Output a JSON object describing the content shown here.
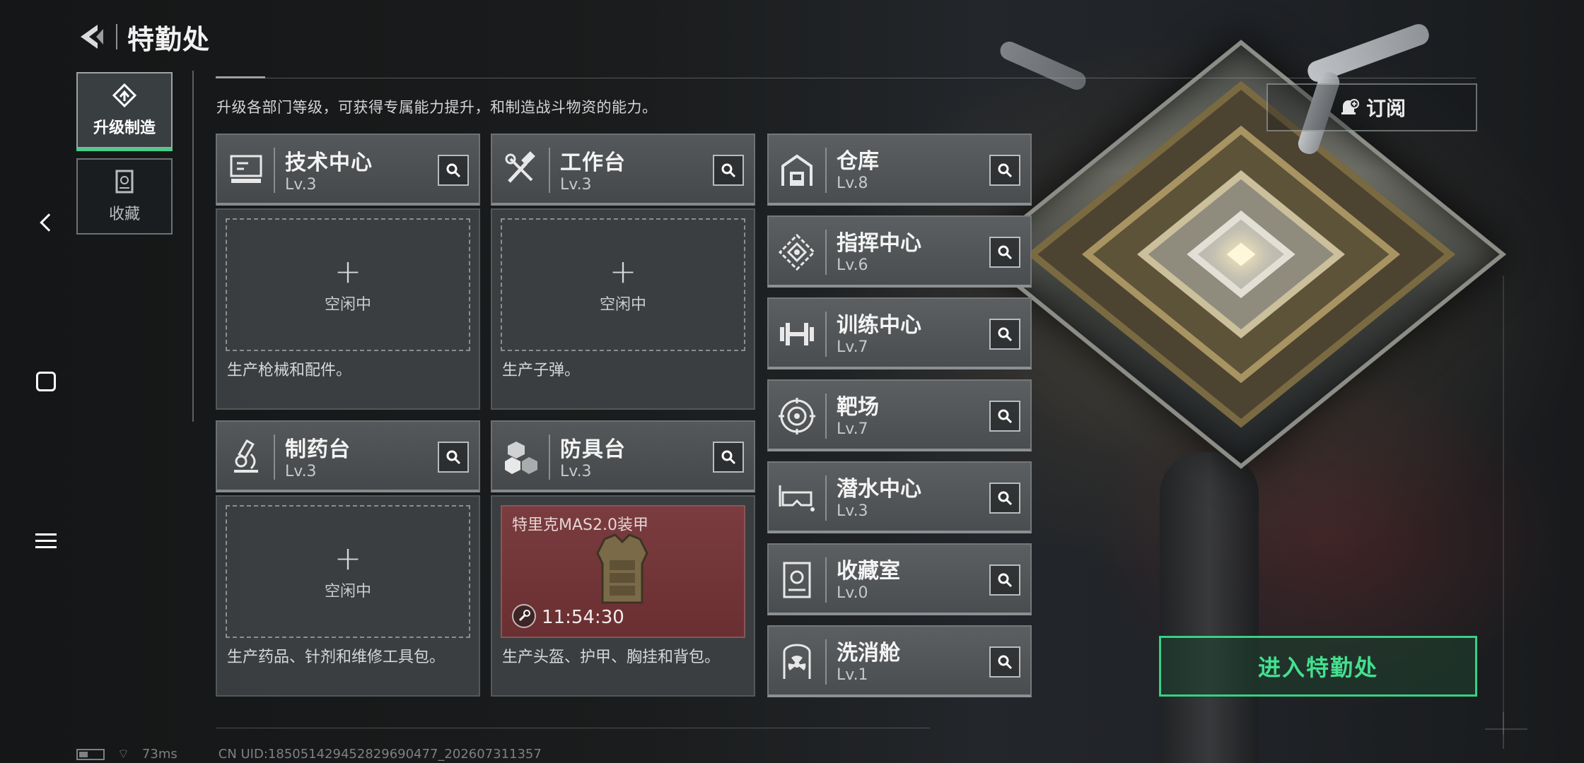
{
  "header": {
    "title": "特勤处"
  },
  "tabs": [
    {
      "label": "升级制造",
      "icon": "upgrade-icon",
      "active": true
    },
    {
      "label": "收藏",
      "icon": "collection-icon",
      "active": false
    }
  ],
  "description": "升级各部门等级，可获得专属能力提升，和制造战斗物资的能力。",
  "subscribe": {
    "label": "订阅",
    "icon": "bell-plus-icon"
  },
  "workstations": [
    {
      "name": "技术中心",
      "level": "Lv.3",
      "icon": "computer-icon",
      "slot_status": "空闲中",
      "plus": "+",
      "desc": "生产枪械和配件。"
    },
    {
      "name": "工作台",
      "level": "Lv.3",
      "icon": "tools-icon",
      "slot_status": "空闲中",
      "plus": "+",
      "desc": "生产子弹。"
    },
    {
      "name": "制药台",
      "level": "Lv.3",
      "icon": "microscope-icon",
      "slot_status": "空闲中",
      "plus": "+",
      "desc": "生产药品、针剂和维修工具包。"
    },
    {
      "name": "防具台",
      "level": "Lv.3",
      "icon": "cubes-icon",
      "crafting_item": "特里克MAS2.0装甲",
      "timer": "11:54:30",
      "desc": "生产头盔、护甲、胸挂和背包。"
    }
  ],
  "facilities": [
    {
      "name": "仓库",
      "level": "Lv.8",
      "icon": "warehouse-icon"
    },
    {
      "name": "指挥中心",
      "level": "Lv.6",
      "icon": "command-icon"
    },
    {
      "name": "训练中心",
      "level": "Lv.7",
      "icon": "dumbbell-icon"
    },
    {
      "name": "靶场",
      "level": "Lv.7",
      "icon": "target-icon"
    },
    {
      "name": "潜水中心",
      "level": "Lv.3",
      "icon": "diving-mask-icon"
    },
    {
      "name": "收藏室",
      "level": "Lv.0",
      "icon": "vault-icon"
    },
    {
      "name": "洗消舱",
      "level": "Lv.1",
      "icon": "radiation-icon"
    }
  ],
  "enter_button": {
    "label": "进入特勤处"
  },
  "footer": {
    "ping": "73ms",
    "uid": "CN UID:18505142945282969047​7_202607311357"
  },
  "colors": {
    "accent": "#38d585",
    "craft_bg": "#7a3c3f"
  }
}
